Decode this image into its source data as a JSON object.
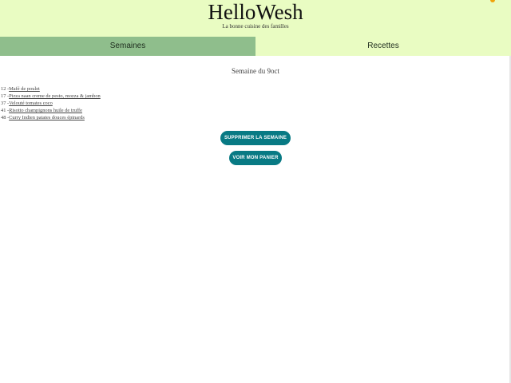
{
  "header": {
    "title": "HelloWesh",
    "subtitle": "La bonne cuisine des familles"
  },
  "nav": {
    "tabs": [
      {
        "label": "Semaines",
        "active": true
      },
      {
        "label": "Recettes",
        "active": false
      }
    ]
  },
  "week": {
    "title": "Semaine du 9oct",
    "meals": [
      {
        "number": "12",
        "name": "Mafé de poulet"
      },
      {
        "number": "17",
        "name": "Pizza naan creme de pesto, mozza & jambon"
      },
      {
        "number": "37",
        "name": "Velouté tomates coco"
      },
      {
        "number": "41",
        "name": "Risotto champignons huile de truffe"
      },
      {
        "number": "48",
        "name": "Curry Indien patates douces épinards"
      }
    ]
  },
  "actions": {
    "delete_week_label": "SUPPRIMER LA SEMAINE",
    "view_cart_label": "VOIR MON PANIER"
  },
  "colors": {
    "header_bg": "#e9fcc2",
    "active_tab_bg": "#8fbe8c",
    "button_bg": "#087a84",
    "accent_dot": "#f0a30a"
  }
}
